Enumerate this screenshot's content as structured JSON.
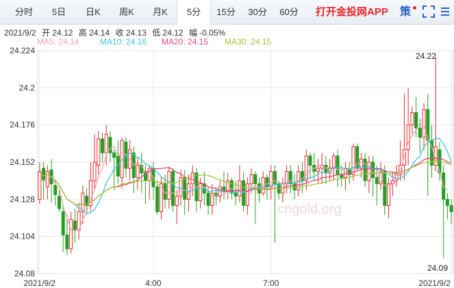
{
  "tabs": [
    {
      "label": "分时",
      "active": false
    },
    {
      "label": "5日",
      "active": false
    },
    {
      "label": "日K",
      "active": false
    },
    {
      "label": "周K",
      "active": false
    },
    {
      "label": "月K",
      "active": false
    },
    {
      "label": "5分",
      "active": true
    },
    {
      "label": "15分",
      "active": false
    },
    {
      "label": "30分",
      "active": false
    },
    {
      "label": "60分",
      "active": false
    }
  ],
  "promo": "打开金投网APP",
  "strategy_label": "策",
  "icons": {
    "fullscreen": "fullscreen-icon",
    "menu": "menu-icon"
  },
  "quote": {
    "date": "2021/9/2",
    "open": "开 24.12",
    "high": "高 24.14",
    "close": "收 24.13",
    "low": "低 24.12",
    "change": "幅 -0.05%"
  },
  "colors": {
    "up": "#e8262a",
    "down": "#22a022",
    "ma5": "#f4a3b6",
    "ma10": "#3cc3d8",
    "ma20": "#e0477a",
    "ma30": "#a8c23c",
    "axis_text": "#333333"
  },
  "watermark": "cngold.org",
  "chart_data": {
    "type": "candlestick",
    "legend": [
      {
        "name": "MA5",
        "label": "MA5: 24.14"
      },
      {
        "name": "MA10",
        "label": "MA10: 24.16"
      },
      {
        "name": "MA20",
        "label": "MA20: 24.15"
      },
      {
        "name": "MA30",
        "label": "MA30: 24.15"
      }
    ],
    "ylim": [
      24.08,
      24.224
    ],
    "yticks": [
      "24.224",
      "24.2",
      "24.176",
      "24.152",
      "24.128",
      "24.104",
      "24.08"
    ],
    "xticks": [
      "2021/9/2",
      "4:00",
      "7:00",
      "2021/9/2"
    ],
    "high_label": "24.22",
    "low_label": "24.09",
    "ohlc": [
      [
        24.128,
        24.146,
        24.125,
        24.152
      ],
      [
        24.148,
        24.14,
        24.128,
        24.152
      ],
      [
        24.136,
        24.146,
        24.128,
        24.15
      ],
      [
        24.147,
        24.138,
        24.126,
        24.154
      ],
      [
        24.137,
        24.131,
        24.124,
        24.14
      ],
      [
        24.13,
        24.122,
        24.12,
        24.134
      ],
      [
        24.12,
        24.105,
        24.094,
        24.125
      ],
      [
        24.105,
        24.096,
        24.092,
        24.118
      ],
      [
        24.096,
        24.115,
        24.093,
        24.12
      ],
      [
        24.114,
        24.108,
        24.1,
        24.122
      ],
      [
        24.108,
        24.12,
        24.102,
        24.126
      ],
      [
        24.12,
        24.132,
        24.112,
        24.137
      ],
      [
        24.13,
        24.124,
        24.118,
        24.135
      ],
      [
        24.124,
        24.14,
        24.12,
        24.152
      ],
      [
        24.14,
        24.152,
        24.134,
        24.17
      ],
      [
        24.15,
        24.167,
        24.144,
        24.172
      ],
      [
        24.167,
        24.158,
        24.152,
        24.171
      ],
      [
        24.158,
        24.17,
        24.15,
        24.176
      ],
      [
        24.168,
        24.158,
        24.152,
        24.172
      ],
      [
        24.158,
        24.155,
        24.134,
        24.16
      ],
      [
        24.156,
        24.143,
        24.138,
        24.166
      ],
      [
        24.142,
        24.166,
        24.135,
        24.168
      ],
      [
        24.165,
        24.148,
        24.142,
        24.168
      ],
      [
        24.148,
        24.16,
        24.14,
        24.166
      ],
      [
        24.158,
        24.142,
        24.132,
        24.162
      ],
      [
        24.142,
        24.15,
        24.134,
        24.155
      ],
      [
        24.15,
        24.145,
        24.132,
        24.158
      ],
      [
        24.146,
        24.14,
        24.125,
        24.15
      ],
      [
        24.14,
        24.148,
        24.128,
        24.15
      ],
      [
        24.148,
        24.136,
        24.128,
        24.152
      ],
      [
        24.136,
        24.12,
        24.118,
        24.14
      ],
      [
        24.12,
        24.138,
        24.115,
        24.142
      ],
      [
        24.138,
        24.128,
        24.122,
        24.144
      ],
      [
        24.128,
        24.146,
        24.122,
        24.149
      ],
      [
        24.146,
        24.124,
        24.12,
        24.148
      ],
      [
        24.124,
        24.13,
        24.112,
        24.134
      ],
      [
        24.13,
        24.142,
        24.124,
        24.147
      ],
      [
        24.142,
        24.128,
        24.118,
        24.147
      ],
      [
        24.128,
        24.138,
        24.12,
        24.144
      ],
      [
        24.138,
        24.145,
        24.13,
        24.15
      ],
      [
        24.145,
        24.127,
        24.12,
        24.148
      ],
      [
        24.127,
        24.138,
        24.122,
        24.142
      ],
      [
        24.138,
        24.132,
        24.124,
        24.146
      ],
      [
        24.132,
        24.124,
        24.118,
        24.136
      ],
      [
        24.124,
        24.132,
        24.118,
        24.138
      ],
      [
        24.132,
        24.13,
        24.124,
        24.136
      ],
      [
        24.13,
        24.136,
        24.126,
        24.14
      ],
      [
        24.136,
        24.133,
        24.128,
        24.146
      ],
      [
        24.133,
        24.14,
        24.128,
        24.145
      ],
      [
        24.14,
        24.132,
        24.128,
        24.142
      ],
      [
        24.132,
        24.13,
        24.124,
        24.14
      ],
      [
        24.13,
        24.14,
        24.126,
        24.15
      ],
      [
        24.14,
        24.124,
        24.12,
        24.146
      ],
      [
        24.124,
        24.138,
        24.118,
        24.142
      ],
      [
        24.138,
        24.144,
        24.132,
        24.148
      ],
      [
        24.144,
        24.138,
        24.112,
        24.146
      ],
      [
        24.138,
        24.132,
        24.126,
        24.142
      ],
      [
        24.132,
        24.142,
        24.13,
        24.146
      ],
      [
        24.142,
        24.136,
        24.128,
        24.144
      ],
      [
        24.136,
        24.146,
        24.128,
        24.15
      ],
      [
        24.146,
        24.138,
        24.1,
        24.15
      ],
      [
        24.138,
        24.132,
        24.128,
        24.14
      ],
      [
        24.132,
        24.138,
        24.126,
        24.142
      ],
      [
        24.138,
        24.146,
        24.132,
        24.15
      ],
      [
        24.146,
        24.138,
        24.132,
        24.15
      ],
      [
        24.138,
        24.134,
        24.128,
        24.144
      ],
      [
        24.134,
        24.146,
        24.13,
        24.15
      ],
      [
        24.146,
        24.14,
        24.132,
        24.152
      ],
      [
        24.14,
        24.156,
        24.134,
        24.16
      ],
      [
        24.156,
        24.15,
        24.142,
        24.158
      ],
      [
        24.15,
        24.146,
        24.14,
        24.158
      ],
      [
        24.146,
        24.148,
        24.138,
        24.154
      ],
      [
        24.148,
        24.15,
        24.138,
        24.158
      ],
      [
        24.15,
        24.145,
        24.138,
        24.156
      ],
      [
        24.145,
        24.148,
        24.14,
        24.154
      ],
      [
        24.148,
        24.156,
        24.14,
        24.158
      ],
      [
        24.156,
        24.144,
        24.136,
        24.16
      ],
      [
        24.144,
        24.142,
        24.136,
        24.15
      ],
      [
        24.142,
        24.148,
        24.134,
        24.152
      ],
      [
        24.148,
        24.144,
        24.138,
        24.152
      ],
      [
        24.144,
        24.162,
        24.14,
        24.164
      ],
      [
        24.162,
        24.148,
        24.146,
        24.164
      ],
      [
        24.148,
        24.154,
        24.142,
        24.158
      ],
      [
        24.154,
        24.14,
        24.136,
        24.158
      ],
      [
        24.14,
        24.152,
        24.132,
        24.156
      ],
      [
        24.152,
        24.142,
        24.13,
        24.156
      ],
      [
        24.142,
        24.138,
        24.124,
        24.15
      ],
      [
        24.138,
        24.146,
        24.134,
        24.152
      ],
      [
        24.146,
        24.124,
        24.118,
        24.15
      ],
      [
        24.124,
        24.138,
        24.116,
        24.142
      ],
      [
        24.138,
        24.14,
        24.13,
        24.146
      ],
      [
        24.14,
        24.144,
        24.136,
        24.15
      ],
      [
        24.144,
        24.15,
        24.14,
        24.166
      ],
      [
        24.15,
        24.16,
        24.14,
        24.196
      ],
      [
        24.16,
        24.176,
        24.15,
        24.2
      ],
      [
        24.176,
        24.184,
        24.17,
        24.188
      ],
      [
        24.184,
        24.174,
        24.168,
        24.194
      ],
      [
        24.174,
        24.168,
        24.158,
        24.18
      ],
      [
        24.168,
        24.186,
        24.16,
        24.19
      ],
      [
        24.186,
        24.166,
        24.13,
        24.196
      ],
      [
        24.166,
        24.15,
        24.142,
        24.176
      ],
      [
        24.15,
        24.162,
        24.146,
        24.22
      ],
      [
        24.16,
        24.145,
        24.14,
        24.165
      ],
      [
        24.145,
        24.128,
        24.09,
        24.15
      ],
      [
        24.128,
        24.124,
        24.115,
        24.132
      ],
      [
        24.124,
        24.12,
        24.112,
        24.128
      ]
    ],
    "ma5": [
      24.141,
      24.14,
      24.142,
      24.143,
      24.138,
      24.135,
      24.124,
      24.116,
      24.108,
      24.108,
      24.108,
      24.115,
      24.12,
      24.128,
      24.134,
      24.143,
      24.148,
      24.157,
      24.161,
      24.162,
      24.156,
      24.158,
      24.157,
      24.154,
      24.15,
      24.152,
      24.15,
      24.145,
      24.146,
      24.142,
      24.138,
      24.136,
      24.132,
      24.132,
      24.132,
      24.133,
      24.134,
      24.134,
      24.132,
      24.137,
      24.136,
      24.136,
      24.136,
      24.134,
      24.13,
      24.131,
      24.131,
      24.131,
      24.134,
      24.135,
      24.134,
      24.135,
      24.133,
      24.133,
      24.135,
      24.137,
      24.136,
      24.137,
      24.138,
      24.139,
      24.14,
      24.139,
      24.138,
      24.139,
      24.14,
      24.139,
      24.14,
      24.141,
      24.144,
      24.147,
      24.148,
      24.15,
      24.15,
      24.148,
      24.149,
      24.149,
      24.147,
      24.148,
      24.146,
      24.148,
      24.148,
      24.151,
      24.152,
      24.151,
      24.149,
      24.145,
      24.144,
      24.139,
      24.137,
      24.137,
      24.137,
      24.14,
      24.146,
      24.156,
      24.165,
      24.169,
      24.173,
      24.177,
      24.175,
      24.167,
      24.162,
      24.154,
      24.146,
      24.136,
      24.134
    ]
  }
}
